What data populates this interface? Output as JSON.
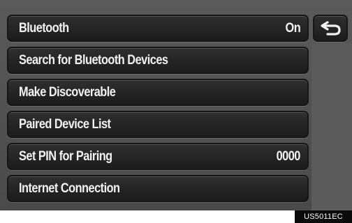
{
  "menu": {
    "items": [
      {
        "label": "Bluetooth",
        "value": "On"
      },
      {
        "label": "Search for Bluetooth Devices",
        "value": ""
      },
      {
        "label": "Make Discoverable",
        "value": ""
      },
      {
        "label": "Paired Device List",
        "value": ""
      },
      {
        "label": "Set PIN for Pairing",
        "value": "0000"
      },
      {
        "label": "Internet Connection",
        "value": ""
      }
    ]
  },
  "back_button": {
    "icon": "back-arrow-icon"
  },
  "footer": {
    "ref_code": "US5011EC"
  },
  "colors": {
    "screen_background": "#555555",
    "button_background": "#262626",
    "button_text": "#f2f2f2"
  }
}
